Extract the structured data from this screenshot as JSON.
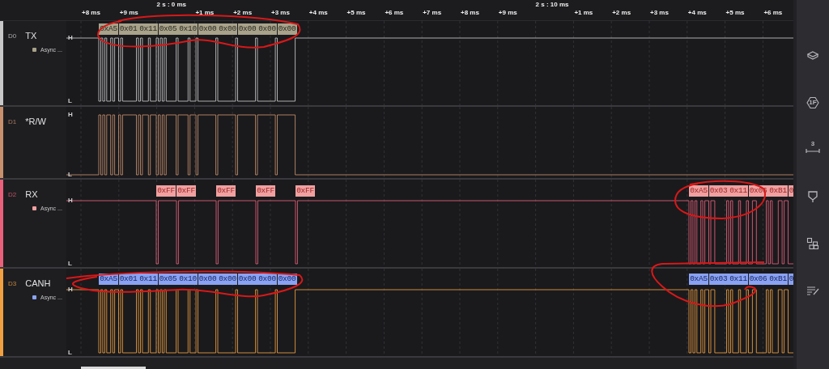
{
  "time_axis": {
    "markers": [
      "2 s : 0 ms",
      "2 s : 10 ms"
    ],
    "ticks": [
      "+8 ms",
      "+9 ms",
      "+1 ms",
      "+2 ms",
      "+3 ms",
      "+4 ms",
      "+5 ms",
      "+6 ms",
      "+7 ms",
      "+8 ms",
      "+9 ms",
      "+1 ms",
      "+2 ms",
      "+3 ms",
      "+4 ms",
      "+5 ms",
      "+6 ms"
    ]
  },
  "channels": [
    {
      "index": "D0",
      "name": "TX",
      "kind": "async",
      "color": "#c8c8c8",
      "high_label": "H",
      "low_label": "L",
      "analyzer": {
        "label": "Async ...",
        "color": "#a8a28a"
      },
      "frames": [
        "0xA5",
        "0x01",
        "0x11",
        "0x05",
        "0x10",
        "0x00",
        "0x00",
        "0x00",
        "0x00",
        "0x00"
      ]
    },
    {
      "index": "D1",
      "name": "*R/W",
      "kind": "gpio",
      "color": "#c8906c",
      "high_label": "H",
      "low_label": "L"
    },
    {
      "index": "D2",
      "name": "RX",
      "kind": "async",
      "color": "#e8607a",
      "high_label": "H",
      "low_label": "L",
      "analyzer": {
        "label": "Async ...",
        "color": "#f0a0a0"
      },
      "frames": [
        "0xFF",
        "0xFF",
        "0xFF",
        "0xFF",
        "0xFF",
        "0xA5",
        "0x03",
        "0x11",
        "0x06",
        "0xB1",
        "0"
      ]
    },
    {
      "index": "D3",
      "name": "CANH",
      "kind": "async",
      "color": "#f0a040",
      "high_label": "H",
      "low_label": "L",
      "analyzer": {
        "label": "Async ...",
        "color": "#8aa2f2"
      },
      "frames": [
        "0xA5",
        "0x01",
        "0x11",
        "0x05",
        "0x10",
        "0x00",
        "0x00",
        "0x00",
        "0x00",
        "0x00",
        "0xA5",
        "0x03",
        "0x11",
        "0x06",
        "0xB1",
        "0"
      ]
    }
  ],
  "sidebar": {
    "tools": [
      {
        "kind": "layers"
      },
      {
        "kind": "hex",
        "badge": "1F"
      },
      {
        "kind": "measure",
        "badge": "3"
      },
      {
        "kind": "filter"
      },
      {
        "kind": "extensions"
      },
      {
        "kind": "notes"
      }
    ]
  }
}
